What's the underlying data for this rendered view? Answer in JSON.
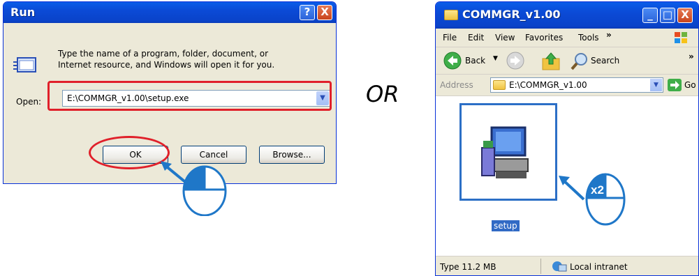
{
  "run_dialog": {
    "title": "Run",
    "help_btn": "?",
    "close_btn": "X",
    "description_line1": "Type the name of a program, folder, document, or",
    "description_line2": "Internet resource, and Windows will open it for you.",
    "open_label": "Open:",
    "open_value": "E:\\COMMGR_v1.00\\setup.exe",
    "ok_label": "OK",
    "cancel_label": "Cancel",
    "browse_label": "Browse..."
  },
  "or_text": "OR",
  "explorer": {
    "title": "COMMGR_v1.00",
    "menu": [
      "File",
      "Edit",
      "View",
      "Favorites",
      "Tools"
    ],
    "menu_more": "»",
    "toolbar": {
      "back": "Back",
      "search": "Search",
      "more": "»"
    },
    "address_label": "Address",
    "address_value": "E:\\COMMGR_v1.00",
    "go_label": "Go",
    "file_name": "setup",
    "status_type": "Type  11.2 MB",
    "status_zone": "Local intranet"
  },
  "mouse2_badge": "x2",
  "colors": {
    "highlight_red": "#e0202a",
    "xp_blue": "#0a4ad6",
    "mouse_blue": "#1f77c8"
  }
}
